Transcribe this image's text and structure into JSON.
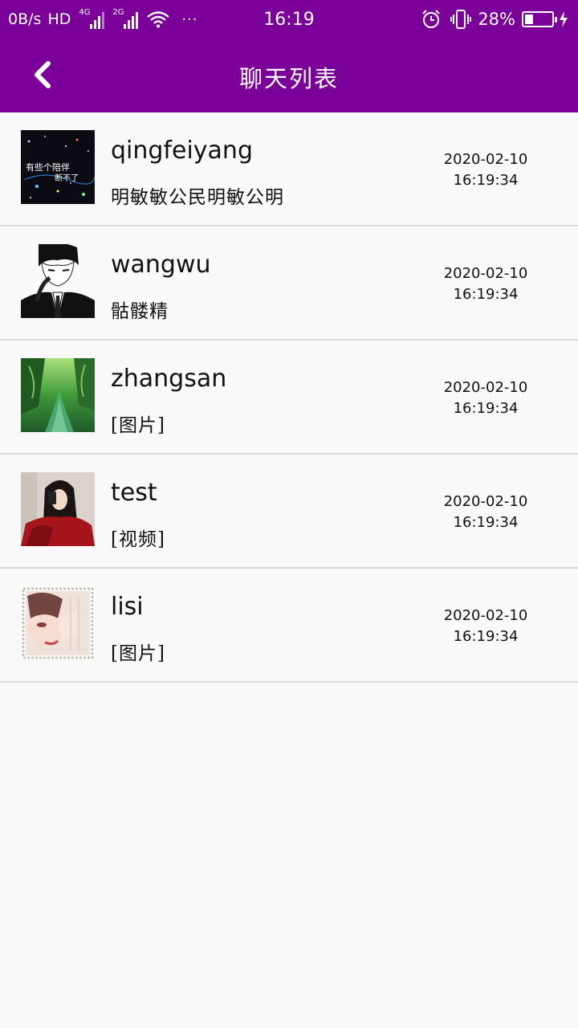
{
  "status_bar": {
    "speed": "0B/s",
    "hd": "HD",
    "net1": "4G",
    "net2": "2G",
    "more": "···",
    "time": "16:19",
    "battery_percent": "28%",
    "battery_level": 0.28,
    "icons": [
      "signal-icon",
      "wifi-icon",
      "alarm-icon",
      "vibrate-icon",
      "battery-icon",
      "charging-icon"
    ]
  },
  "header": {
    "title": "聊天列表",
    "back_icon": "chevron-left-icon"
  },
  "colors": {
    "primary": "#7b0099",
    "background": "#f9f9f9",
    "divider": "#dadada"
  },
  "chats": [
    {
      "name": "qingfeiyang",
      "preview": "明敏敏公民明敏公明",
      "date": "2020-02-10",
      "time": "16:19:34",
      "avatar_text": [
        "有些个陪伴",
        "断不了"
      ]
    },
    {
      "name": "wangwu",
      "preview": "骷髅精",
      "date": "2020-02-10",
      "time": "16:19:34"
    },
    {
      "name": "zhangsan",
      "preview": "[图片]",
      "date": "2020-02-10",
      "time": "16:19:34"
    },
    {
      "name": "test",
      "preview": "[视频]",
      "date": "2020-02-10",
      "time": "16:19:34"
    },
    {
      "name": "lisi",
      "preview": "[图片]",
      "date": "2020-02-10",
      "time": "16:19:34"
    }
  ]
}
